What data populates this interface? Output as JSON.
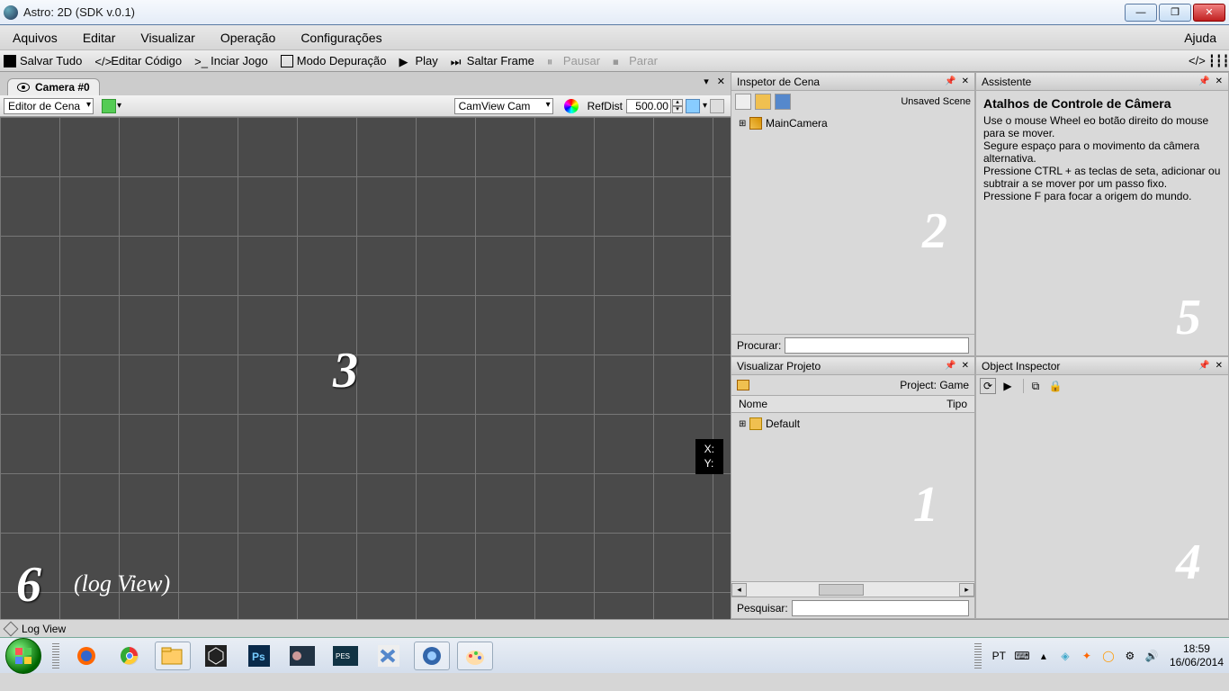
{
  "window": {
    "title": "Astro: 2D (SDK v.0.1)"
  },
  "menubar": {
    "items": [
      "Aquivos",
      "Editar",
      "Visualizar",
      "Operação",
      "Configurações"
    ],
    "help": "Ajuda"
  },
  "toolbar": {
    "save_all": "Salvar Tudo",
    "edit_code": "Editar Código",
    "start_game": "Inciar Jogo",
    "debug_mode": "Modo Depuração",
    "play": "Play",
    "skip_frame": "Saltar Frame",
    "pause": "Pausar",
    "stop": "Parar"
  },
  "camera_tab": {
    "label": "Camera #0"
  },
  "view_toolbar": {
    "left_combo": "Editor de Cena",
    "cam_combo": "CamView Cam",
    "refdist_label": "RefDist",
    "refdist_value": "500.00"
  },
  "overlay": {
    "num3": "3",
    "num6": "6",
    "logview": "(log View)",
    "coord_x": "X:",
    "coord_y": "Y:"
  },
  "scene_inspector": {
    "title": "Inspetor de Cena",
    "status": "Unsaved Scene",
    "root": "MainCamera",
    "search_label": "Procurar:",
    "ghost": "2"
  },
  "assistant": {
    "title": "Assistente",
    "heading": "Atalhos de Controle de Câmera",
    "line1": "Use o mouse Wheel eo botão direito do mouse para se mover.",
    "line2": "Segure espaço para o movimento da câmera alternativa.",
    "line3": "Pressione CTRL + as teclas de seta, adicionar ou subtrair a se mover por um passo fixo.",
    "line4": "Pressione F para focar a origem do mundo.",
    "ghost": "5"
  },
  "project_view": {
    "title": "Visualizar Projeto",
    "project_label": "Project: Game",
    "col_name": "Nome",
    "col_type": "Tipo",
    "root": "Default",
    "search_label": "Pesquisar:",
    "ghost": "1"
  },
  "object_inspector": {
    "title": "Object Inspector",
    "ghost": "4"
  },
  "log_tab": {
    "label": "Log View"
  },
  "tray": {
    "lang": "PT",
    "time": "18:59",
    "date": "16/06/2014"
  }
}
